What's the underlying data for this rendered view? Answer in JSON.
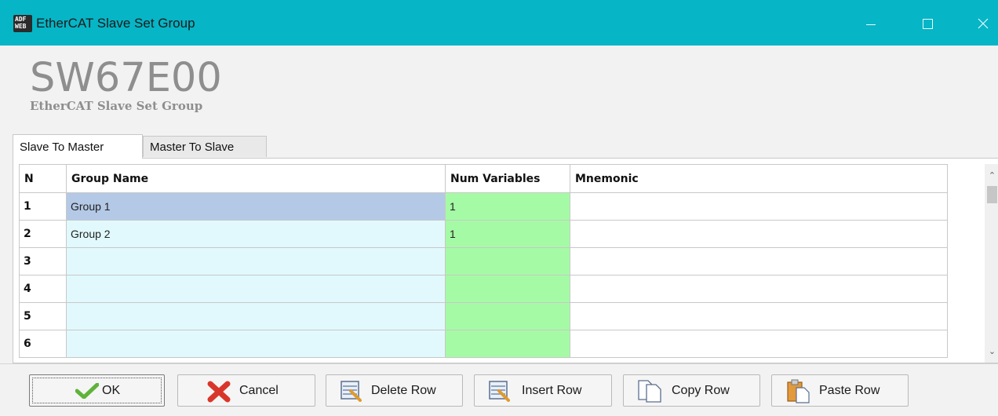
{
  "window": {
    "title": "EtherCAT Slave Set Group",
    "icon_text_top": "ADF",
    "icon_text_bottom": "WEB",
    "controls": [
      "minimize-icon",
      "maximize-icon",
      "close-icon"
    ]
  },
  "header": {
    "product_code": "SW67E00",
    "subtitle": "EtherCAT Slave Set Group"
  },
  "tabs": [
    {
      "label": "Slave To Master",
      "active": true
    },
    {
      "label": "Master To Slave",
      "active": false
    }
  ],
  "grid": {
    "columns": [
      "N",
      "Group Name",
      "Num Variables",
      "Mnemonic"
    ],
    "rows": [
      {
        "n": "1",
        "group_name": "Group 1",
        "num_variables": "1",
        "mnemonic": "",
        "selected": true
      },
      {
        "n": "2",
        "group_name": "Group 2",
        "num_variables": "1",
        "mnemonic": ""
      },
      {
        "n": "3",
        "group_name": "",
        "num_variables": "",
        "mnemonic": ""
      },
      {
        "n": "4",
        "group_name": "",
        "num_variables": "",
        "mnemonic": ""
      },
      {
        "n": "5",
        "group_name": "",
        "num_variables": "",
        "mnemonic": ""
      },
      {
        "n": "6",
        "group_name": "",
        "num_variables": "",
        "mnemonic": ""
      }
    ]
  },
  "buttons": {
    "ok": "OK",
    "cancel": "Cancel",
    "delete_row": "Delete Row",
    "insert_row": "Insert Row",
    "copy_row": "Copy Row",
    "paste_row": "Paste Row"
  },
  "colors": {
    "titlebar": "#06b5c6",
    "group_name_cell": "#e1f9fc",
    "selected_cell": "#b4c9e6",
    "num_variables_cell": "#a5fba5"
  }
}
